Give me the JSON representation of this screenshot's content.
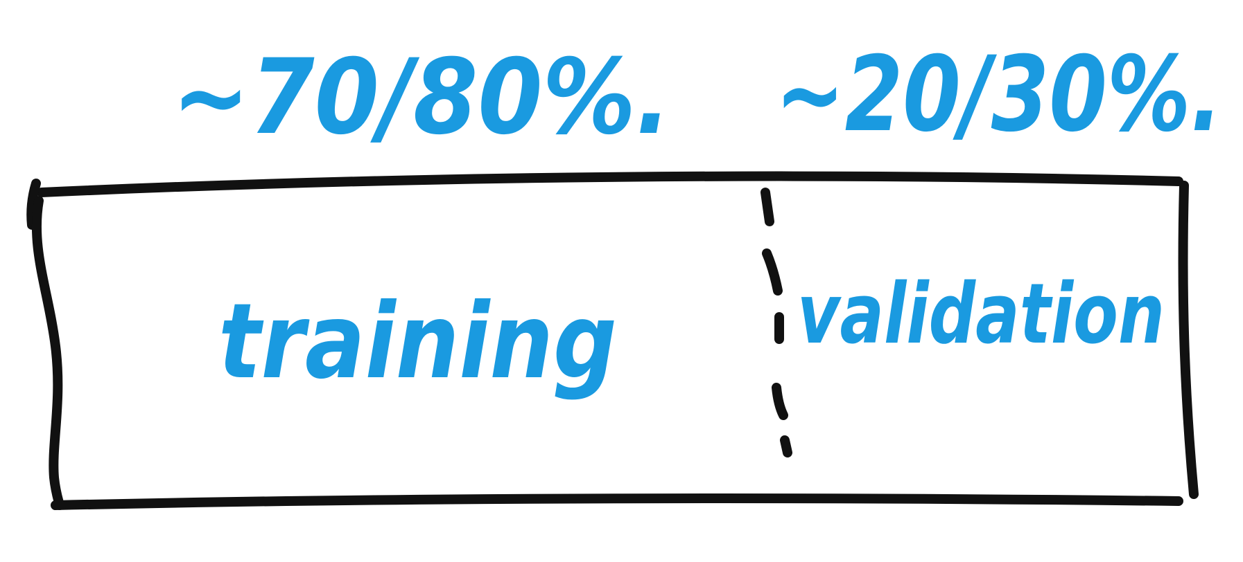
{
  "colors": {
    "ink": "#111111",
    "accent": "#1a9ae0",
    "background": "#ffffff"
  },
  "labels": {
    "train_ratio": "~70/80%.",
    "val_ratio": "~20/30%.",
    "train_segment": "training",
    "val_segment": "validation"
  }
}
